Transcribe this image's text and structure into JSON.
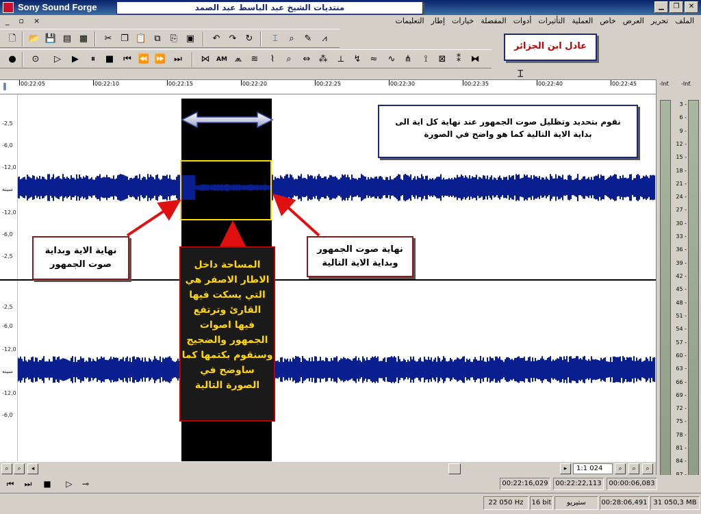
{
  "window": {
    "app_title": "Sony Sound Forge",
    "forum_banner": "منتديات الشيخ عبد الباسط عبد الصمد",
    "buttons": [
      "▁",
      "❐",
      "✕"
    ]
  },
  "menu": {
    "items": [
      "الملف",
      "تحرير",
      "العرض",
      "خاص",
      "العملية",
      "التأثيرات",
      "أدوات",
      "المفضلة",
      "خيارات",
      "إطار",
      "التعليمات"
    ],
    "mdi_buttons": [
      "_",
      "▫",
      "×"
    ]
  },
  "author_box": "عادل ابن الجزائر",
  "ruler": {
    "labels": [
      "00:22:05",
      "00:22:10",
      "00:22:15",
      "00:22:20",
      "00:22:25",
      "00:22:30",
      "00:22:35",
      "00:22:40",
      "00:22:45"
    ]
  },
  "db_labels": {
    "ch1": [
      "-2,5",
      "-6,0",
      "-12,0",
      "سينه",
      "-12,0",
      "-6,0",
      "-2,5"
    ],
    "ch2": [
      "-2,5",
      "-6,0",
      "-12,0",
      "سينه",
      "-12,0",
      "-6,0"
    ]
  },
  "callouts": {
    "info_line1": "نقوم بتحديد وتظليل صوت الجمهور عند نهاية كل اية الى",
    "info_line2": "بداية الاية التالية كما هو واضح في الصورة",
    "left_line1": "نهاية الاية وبداية",
    "left_line2": "صوت الجمهور",
    "right_line1": "نهاية صوت الجمهور",
    "right_line2": "وبداية الاية التالية",
    "center_lines": [
      "المساحة داخل",
      "الاطار الاصفر هي",
      "التي يسكت فيها",
      "القارئ وترتفع",
      "فيها اصوات",
      "الجمهور والضجيج",
      "وسنقوم بكتمها كما",
      "ساوضح في",
      "الصورة التالية"
    ]
  },
  "meters": {
    "inf_left": "-Inf.",
    "inf_right": "-Inf.",
    "scale": [
      "3",
      "6",
      "9",
      "12",
      "15",
      "18",
      "21",
      "24",
      "27",
      "30",
      "33",
      "36",
      "39",
      "42",
      "45",
      "48",
      "51",
      "54",
      "57",
      "60",
      "63",
      "66",
      "69",
      "72",
      "75",
      "78",
      "81",
      "84",
      "87"
    ]
  },
  "scroll": {
    "zoom": "1:1 024"
  },
  "transport": {
    "time_cursor": "00:22:16,029",
    "time_sel_start": "00:22:22,113",
    "time_sel_len": "00:00:06,083"
  },
  "status": {
    "rate": "22 050 Hz",
    "bits": "16 bit",
    "channels": "ستيريو",
    "length": "00:28:06,491",
    "size": "31 050,3 MB"
  },
  "colors": {
    "waveform": "#0a1f8f",
    "selection": "#000000",
    "yellow_frame": "#ffd800",
    "callout_border": "#8b1a1a",
    "arrow": "#e01010"
  }
}
